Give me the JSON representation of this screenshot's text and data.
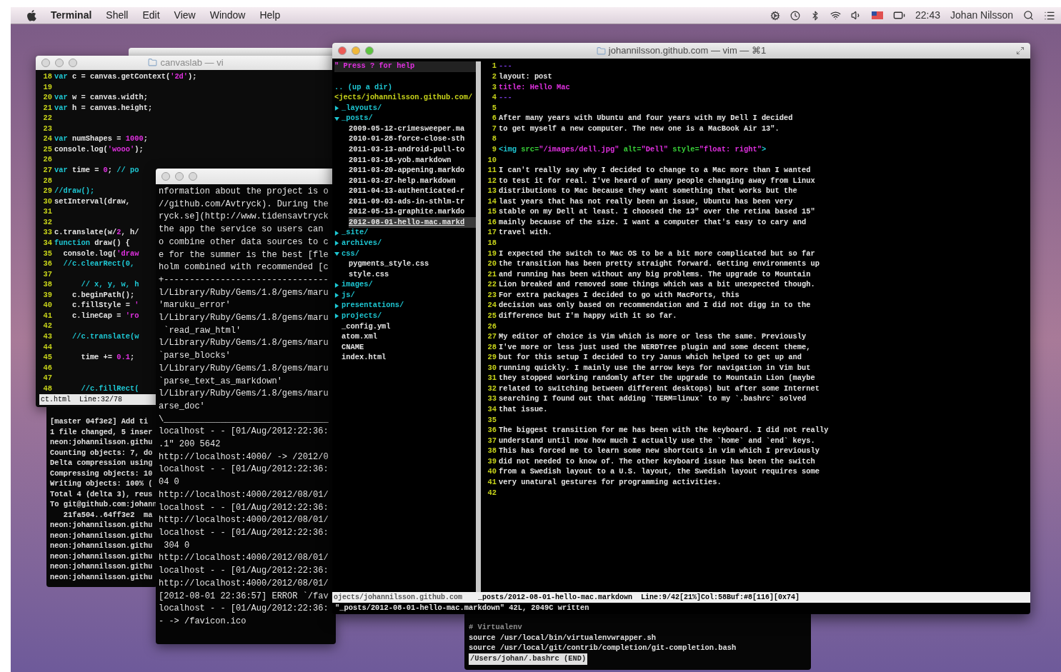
{
  "menu_bar": {
    "app": "Terminal",
    "menus": [
      "Shell",
      "Edit",
      "View",
      "Window",
      "Help"
    ],
    "clock": "22:43",
    "user": "Johan Nilsson"
  },
  "canvas_vim": {
    "title": "canvaslab — vi",
    "active": false,
    "lines": [
      {
        "num": "18",
        "segments": [
          {
            "kind": "keyword",
            "text": "var"
          },
          {
            "kind": "plain",
            "text": " c = canvas.getContext("
          },
          {
            "kind": "string",
            "text": "'2d'"
          },
          {
            "kind": "plain",
            "text": ");"
          }
        ]
      },
      {
        "num": "19"
      },
      {
        "num": "20",
        "segments": [
          {
            "kind": "keyword",
            "text": "var"
          },
          {
            "kind": "plain",
            "text": " w = canvas.width;"
          }
        ]
      },
      {
        "num": "21",
        "segments": [
          {
            "kind": "keyword",
            "text": "var"
          },
          {
            "kind": "plain",
            "text": " h = canvas.height;"
          }
        ]
      },
      {
        "num": "22"
      },
      {
        "num": "23"
      },
      {
        "num": "24",
        "segments": [
          {
            "kind": "keyword",
            "text": "var"
          },
          {
            "kind": "plain",
            "text": " numShapes = "
          },
          {
            "kind": "number",
            "text": "1000"
          },
          {
            "kind": "plain",
            "text": ";"
          }
        ]
      },
      {
        "num": "25",
        "segments": [
          {
            "kind": "plain",
            "text": "console.log("
          },
          {
            "kind": "string",
            "text": "'wooo'"
          },
          {
            "kind": "plain",
            "text": ");"
          }
        ]
      },
      {
        "num": "26"
      },
      {
        "num": "27",
        "segments": [
          {
            "kind": "keyword",
            "text": "var"
          },
          {
            "kind": "plain",
            "text": " time = "
          },
          {
            "kind": "number",
            "text": "0"
          },
          {
            "kind": "plain",
            "text": "; "
          },
          {
            "kind": "comment",
            "text": "// po"
          }
        ]
      },
      {
        "num": "28"
      },
      {
        "num": "29",
        "segments": [
          {
            "kind": "comment",
            "text": "//draw();"
          }
        ]
      },
      {
        "num": "30",
        "segments": [
          {
            "kind": "plain",
            "text": "setInterval(draw,"
          }
        ]
      },
      {
        "num": "31"
      },
      {
        "num": "32"
      },
      {
        "num": "33",
        "segments": [
          {
            "kind": "plain",
            "text": "c.translate(w/"
          },
          {
            "kind": "number",
            "text": "2"
          },
          {
            "kind": "plain",
            "text": ", h/"
          }
        ]
      },
      {
        "num": "34",
        "segments": [
          {
            "kind": "keyword",
            "text": "function"
          },
          {
            "kind": "plain",
            "text": " draw() {"
          }
        ]
      },
      {
        "num": "35",
        "segments": [
          {
            "kind": "plain",
            "text": "  console.log("
          },
          {
            "kind": "string",
            "text": "'draw"
          }
        ]
      },
      {
        "num": "36",
        "segments": [
          {
            "kind": "comment",
            "text": "  //c.clearRect(0,"
          }
        ]
      },
      {
        "num": "37"
      },
      {
        "num": "38",
        "segments": [
          {
            "kind": "comment",
            "text": "      // x, y, w, h"
          }
        ]
      },
      {
        "num": "39",
        "segments": [
          {
            "kind": "plain",
            "text": "    c.beginPath();"
          }
        ]
      },
      {
        "num": "40",
        "segments": [
          {
            "kind": "plain",
            "text": "    c.fillStyle = "
          },
          {
            "kind": "string",
            "text": "'"
          }
        ]
      },
      {
        "num": "41",
        "segments": [
          {
            "kind": "plain",
            "text": "    c.lineCap = "
          },
          {
            "kind": "string",
            "text": "'ro"
          }
        ]
      },
      {
        "num": "42"
      },
      {
        "num": "43",
        "segments": [
          {
            "kind": "comment",
            "text": "    //c.translate(w"
          }
        ]
      },
      {
        "num": "44"
      },
      {
        "num": "45",
        "segments": [
          {
            "kind": "plain",
            "text": "      time += "
          },
          {
            "kind": "number",
            "text": "0.1"
          },
          {
            "kind": "plain",
            "text": ";"
          }
        ]
      },
      {
        "num": "46"
      },
      {
        "num": "47"
      },
      {
        "num": "48",
        "segments": [
          {
            "kind": "comment",
            "text": "      //c.fillRect("
          }
        ]
      }
    ],
    "status_line": "ct.html  Line:32/78"
  },
  "git_terminal": {
    "lines": [
      "[master 04f3e2] Add ti",
      "1 file changed, 5 inser",
      "neon:johannilsson.githu",
      "Counting objects: 7, do",
      "Delta compression using",
      "Compressing objects: 10",
      "Writing objects: 100% (",
      "Total 4 (delta 3), reus",
      "To git@github.com:johann",
      "   21fa504..64ff3e2  ma",
      "neon:johannilsson.githu",
      "neon:johannilsson.githu",
      "neon:johannilsson.githu",
      "neon:johannilsson.githu",
      "neon:johannilsson.githu",
      "neon:johannilsson.githu"
    ]
  },
  "server_log": {
    "active": false,
    "lines": [
      "nformation about the project is o",
      "//github.com/Avtryck). During the",
      "ryck.se](http://www.tidensavtryck",
      "the app the service so users can",
      "o combine other data sources to c",
      "e for the summer is the best [fle",
      "holm combined with recommended [c",
      "+--------------------------------",
      "l/Library/Ruby/Gems/1.8/gems/maru",
      "'maruku_error'",
      "l/Library/Ruby/Gems/1.8/gems/maru",
      " `read_raw_html'",
      "l/Library/Ruby/Gems/1.8/gems/maru",
      "`parse_blocks'",
      "l/Library/Ruby/Gems/1.8/gems/maru",
      "`parse_text_as_markdown'",
      "l/Library/Ruby/Gems/1.8/gems/maru",
      "arse_doc'",
      "\\________________________________",
      "localhost - - [01/Aug/2012:22:36:",
      ".1\" 200 5642",
      "http://localhost:4000/ -> /2012/0",
      "localhost - - [01/Aug/2012:22:36:",
      "04 0",
      "http://localhost:4000/2012/08/01/",
      "localhost - - [01/Aug/2012:22:36:",
      "http://localhost:4000/2012/08/01/",
      "localhost - - [01/Aug/2012:22:36:",
      " 304 0",
      "http://localhost:4000/2012/08/01/",
      "localhost - - [01/Aug/2012:22:36:",
      "http://localhost:4000/2012/08/01/",
      "[2012-08-01 22:36:57] ERROR `/fav",
      "localhost - - [01/Aug/2012:22:36:",
      "- -> /favicon.ico"
    ]
  },
  "bashrc_pager": {
    "lines": [
      {
        "kind": "comment",
        "text": "# Virtualenv"
      },
      {
        "kind": "plain",
        "text": "source /usr/local/bin/virtualenvwrapper.sh"
      },
      {
        "kind": "plain",
        "text": "source /usr/local/git/contrib/completion/git-completion.bash"
      },
      {
        "kind": "prompt",
        "text": "/Users/johan/.bashrc (END)"
      }
    ]
  },
  "blog_vim": {
    "title": "johannilsson.github.com — vim — ⌘1",
    "active": true,
    "nerdtree": {
      "help": "\" Press ? for help",
      "up": ".. (up a dir)",
      "root": "<jects/johannilsson.github.com/",
      "items": [
        {
          "name": "_layouts/",
          "kind": "dir",
          "expanded": false,
          "selected": false
        },
        {
          "name": "_posts/",
          "kind": "dir",
          "expanded": true,
          "selected": false,
          "children": [
            {
              "name": "2009-05-12-crimesweeper.ma",
              "kind": "file",
              "selected": false
            },
            {
              "name": "2010-01-28-force-close-sth",
              "kind": "file",
              "selected": false
            },
            {
              "name": "2011-03-13-android-pull-to",
              "kind": "file",
              "selected": false
            },
            {
              "name": "2011-03-16-yob.markdown",
              "kind": "file",
              "selected": false
            },
            {
              "name": "2011-03-20-appening.markdo",
              "kind": "file",
              "selected": false
            },
            {
              "name": "2011-03-27-help.markdown",
              "kind": "file",
              "selected": false
            },
            {
              "name": "2011-04-13-authenticated-r",
              "kind": "file",
              "selected": false
            },
            {
              "name": "2011-09-03-ads-in-sthlm-tr",
              "kind": "file",
              "selected": false
            },
            {
              "name": "2012-05-13-graphite.markdo",
              "kind": "file",
              "selected": false
            },
            {
              "name": "2012-08-01-hello-mac.markd",
              "kind": "file",
              "selected": true
            }
          ]
        },
        {
          "name": "_site/",
          "kind": "dir",
          "expanded": false,
          "selected": false
        },
        {
          "name": "archives/",
          "kind": "dir",
          "expanded": false,
          "selected": false
        },
        {
          "name": "css/",
          "kind": "dir",
          "expanded": true,
          "selected": false,
          "children": [
            {
              "name": "pygments_style.css",
              "kind": "file",
              "selected": false
            },
            {
              "name": "style.css",
              "kind": "file",
              "selected": false
            }
          ]
        },
        {
          "name": "images/",
          "kind": "dir",
          "expanded": false,
          "selected": false
        },
        {
          "name": "js/",
          "kind": "dir",
          "expanded": false,
          "selected": false
        },
        {
          "name": "presentations/",
          "kind": "dir",
          "expanded": false,
          "selected": false
        },
        {
          "name": "projects/",
          "kind": "dir",
          "expanded": false,
          "selected": false
        },
        {
          "name": "_config.yml",
          "kind": "file",
          "selected": false
        },
        {
          "name": "atom.xml",
          "kind": "file",
          "selected": false
        },
        {
          "name": "CNAME",
          "kind": "file",
          "selected": false
        },
        {
          "name": "index.html",
          "kind": "file",
          "selected": false
        }
      ]
    },
    "lines": [
      {
        "num": "1",
        "segments": [
          {
            "kind": "frontmatter",
            "text": "---"
          }
        ]
      },
      {
        "num": "2",
        "segments": [
          {
            "kind": "plain",
            "text": "layout: post"
          }
        ]
      },
      {
        "num": "3",
        "segments": [
          {
            "kind": "heading",
            "text": "title: Hello Mac"
          }
        ]
      },
      {
        "num": "4",
        "segments": [
          {
            "kind": "frontmatter",
            "text": "---"
          }
        ]
      },
      {
        "num": "5"
      },
      {
        "num": "6",
        "segments": [
          {
            "kind": "plain",
            "text": "After many years with Ubuntu and four years with my Dell I decided"
          }
        ]
      },
      {
        "num": "7",
        "segments": [
          {
            "kind": "plain",
            "text": "to get myself a new computer. The new one is a MacBook Air 13\"."
          }
        ]
      },
      {
        "num": "8"
      },
      {
        "num": "9",
        "segments": [
          {
            "kind": "tag",
            "text": "<img "
          },
          {
            "kind": "attr",
            "text": "src="
          },
          {
            "kind": "string",
            "text": "\"/images/dell.jpg\" "
          },
          {
            "kind": "attr",
            "text": "alt="
          },
          {
            "kind": "string",
            "text": "\"Dell\" "
          },
          {
            "kind": "attr",
            "text": "style="
          },
          {
            "kind": "string",
            "text": "\"float: right\""
          },
          {
            "kind": "tag",
            "text": ">"
          }
        ]
      },
      {
        "num": "10"
      },
      {
        "num": "11",
        "segments": [
          {
            "kind": "plain",
            "text": "I can't really say why I decided to change to a Mac more than I wanted"
          }
        ]
      },
      {
        "num": "12",
        "segments": [
          {
            "kind": "plain",
            "text": "to test it for real. I've heard of many people changing away from Linux"
          }
        ]
      },
      {
        "num": "13",
        "segments": [
          {
            "kind": "plain",
            "text": "distributions to Mac because they want something that works but the"
          }
        ]
      },
      {
        "num": "14",
        "segments": [
          {
            "kind": "plain",
            "text": "last years that has not really been an issue, Ubuntu has been very"
          }
        ]
      },
      {
        "num": "15",
        "segments": [
          {
            "kind": "plain",
            "text": "stable on my Dell at least. I choosed the 13\" over the retina based 15\""
          }
        ]
      },
      {
        "num": "16",
        "segments": [
          {
            "kind": "plain",
            "text": "mainly because of the size. I want a computer that's easy to cary and"
          }
        ]
      },
      {
        "num": "17",
        "segments": [
          {
            "kind": "plain",
            "text": "travel with."
          }
        ]
      },
      {
        "num": "18"
      },
      {
        "num": "19",
        "segments": [
          {
            "kind": "plain",
            "text": "I expected the switch to Mac OS to be a bit more complicated but so far"
          }
        ]
      },
      {
        "num": "20",
        "segments": [
          {
            "kind": "plain",
            "text": "the transition has been pretty straight forward. Getting environments up"
          }
        ]
      },
      {
        "num": "21",
        "segments": [
          {
            "kind": "plain",
            "text": "and running has been without any big problems. The upgrade to Mountain"
          }
        ]
      },
      {
        "num": "22",
        "segments": [
          {
            "kind": "plain",
            "text": "Lion breaked and removed some things which was a bit unexpected though."
          }
        ]
      },
      {
        "num": "23",
        "segments": [
          {
            "kind": "plain",
            "text": "For extra packages I decided to go with MacPorts, this"
          }
        ]
      },
      {
        "num": "24",
        "segments": [
          {
            "kind": "plain",
            "text": "decision was only based on recommendation and I did not digg in to the"
          }
        ]
      },
      {
        "num": "25",
        "segments": [
          {
            "kind": "plain",
            "text": "difference but I'm happy with it so far."
          }
        ]
      },
      {
        "num": "26"
      },
      {
        "num": "27",
        "segments": [
          {
            "kind": "plain",
            "text": "My editor of choice is Vim which is more or less the same. Previously"
          }
        ]
      },
      {
        "num": "28",
        "segments": [
          {
            "kind": "plain",
            "text": "I've more or less just used the NERDTree plugin and some decent theme,"
          }
        ]
      },
      {
        "num": "29",
        "segments": [
          {
            "kind": "plain",
            "text": "but for this setup I decided to try Janus which helped to get up and"
          }
        ]
      },
      {
        "num": "30",
        "segments": [
          {
            "kind": "plain",
            "text": "running quickly. I mainly use the arrow keys for navigation in Vim but"
          }
        ]
      },
      {
        "num": "31",
        "segments": [
          {
            "kind": "plain",
            "text": "they stopped working randomly after the upgrade to Mountain Lion (maybe"
          }
        ]
      },
      {
        "num": "32",
        "segments": [
          {
            "kind": "plain",
            "text": "related to switching between different desktops) but after some Internet"
          }
        ]
      },
      {
        "num": "33",
        "segments": [
          {
            "kind": "plain",
            "text": "searching I found out that adding `TERM=linux` to my `.bashrc` solved"
          }
        ]
      },
      {
        "num": "34",
        "segments": [
          {
            "kind": "plain",
            "text": "that issue."
          }
        ]
      },
      {
        "num": "35"
      },
      {
        "num": "36",
        "segments": [
          {
            "kind": "plain",
            "text": "The biggest transition for me has been with the keyboard. I did not really"
          }
        ]
      },
      {
        "num": "37",
        "segments": [
          {
            "kind": "plain",
            "text": "understand until now how much I actually use the `home` and `end` keys."
          }
        ]
      },
      {
        "num": "38",
        "segments": [
          {
            "kind": "plain",
            "text": "This has forced me to learn some new shortcuts in vim which I previously"
          }
        ]
      },
      {
        "num": "39",
        "segments": [
          {
            "kind": "plain",
            "text": "did not needed to know of. The other keyboard issue has been the switch"
          }
        ]
      },
      {
        "num": "40",
        "segments": [
          {
            "kind": "plain",
            "text": "from a Swedish layout to a U.S. layout, the Swedish layout requires some"
          }
        ]
      },
      {
        "num": "41",
        "segments": [
          {
            "kind": "plain",
            "text": "very unatural gestures for programming activities."
          }
        ]
      },
      {
        "num": "42"
      }
    ],
    "tree_status": "ojects/johannilsson.github.com",
    "status_line": "_posts/2012-08-01-hello-mac.markdown  Line:9/42[21%]Col:58Buf:#8[116][0x74]",
    "command_line": "\"_posts/2012-08-01-hello-mac.markdown\" 42L, 2049C written"
  }
}
